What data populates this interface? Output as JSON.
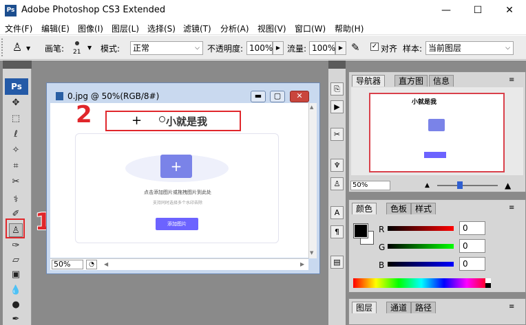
{
  "window": {
    "title": "Adobe Photoshop CS3 Extended",
    "logo": "Ps"
  },
  "menu": [
    "文件(F)",
    "编辑(E)",
    "图像(I)",
    "图层(L)",
    "选择(S)",
    "滤镜(T)",
    "分析(A)",
    "视图(V)",
    "窗口(W)",
    "帮助(H)"
  ],
  "options": {
    "brush_label": "画笔:",
    "brush_size": "21",
    "mode_label": "模式:",
    "mode_value": "正常",
    "opacity_label": "不透明度:",
    "opacity_value": "100%",
    "flow_label": "流量:",
    "flow_value": "100%",
    "align_label": "对齐",
    "sample_label": "样本:",
    "sample_value": "当前图层"
  },
  "document": {
    "title": "0.jpg @ 50%(RGB/8#)",
    "zoom": "50%",
    "canvas": {
      "heading": "小就是我",
      "upload_text": "点击添加图片或拖拽图片到此处",
      "upload_link1": "添加图片",
      "upload_link2": "拖拽图片",
      "sub_text": "支持同时选择多个水印去除",
      "button": "添加图片"
    }
  },
  "annotations": {
    "label1": "1",
    "label2": "2",
    "color": "#e0262b"
  },
  "navigator": {
    "tabs": [
      "导航器",
      "直方图",
      "信息"
    ],
    "zoom": "50%"
  },
  "color_panel": {
    "tabs": [
      "颜色",
      "色板",
      "样式"
    ],
    "channels": [
      {
        "label": "R",
        "value": "0"
      },
      {
        "label": "G",
        "value": "0"
      },
      {
        "label": "B",
        "value": "0"
      }
    ]
  },
  "layers_panel": {
    "tabs": [
      "图层",
      "通道",
      "路径"
    ]
  },
  "colors": {
    "workspace": "#8a8a8a",
    "panel": "#d6d6d6",
    "accent": "#6c63ff"
  }
}
